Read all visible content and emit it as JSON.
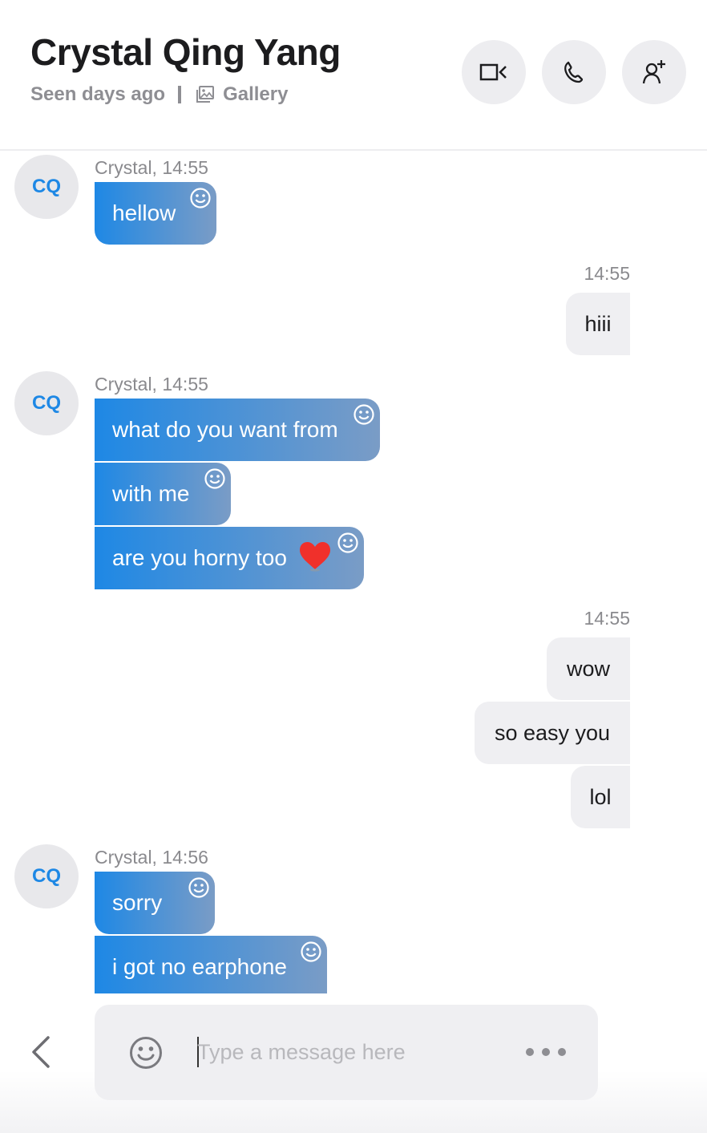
{
  "header": {
    "contact_name": "Crystal Qing Yang",
    "status": "Seen days ago",
    "gallery_label": "Gallery",
    "actions": [
      "video-call-icon",
      "phone-icon",
      "add-person-icon"
    ]
  },
  "avatar_initials": "CQ",
  "colors": {
    "incoming_gradient_start": "#1e88e5",
    "incoming_gradient_end": "#7a9cc6",
    "outgoing_bubble": "#efeff2",
    "heart": "#f0302b"
  },
  "messages": [
    {
      "direction": "incoming",
      "meta": "Crystal, 14:55",
      "bubbles": [
        "hellow"
      ]
    },
    {
      "direction": "outgoing",
      "meta": "14:55",
      "bubbles": [
        "hiii"
      ]
    },
    {
      "direction": "incoming",
      "meta": "Crystal, 14:55",
      "bubbles": [
        "what do you want from",
        "with me",
        "are you horny too"
      ]
    },
    {
      "direction": "outgoing",
      "meta": "14:55",
      "bubbles": [
        "wow",
        "so easy you",
        "lol"
      ]
    },
    {
      "direction": "incoming",
      "meta": "Crystal, 14:56",
      "bubbles": [
        "sorry",
        "i got no earphone"
      ]
    }
  ],
  "composer": {
    "placeholder": "Type a message here",
    "value": ""
  }
}
